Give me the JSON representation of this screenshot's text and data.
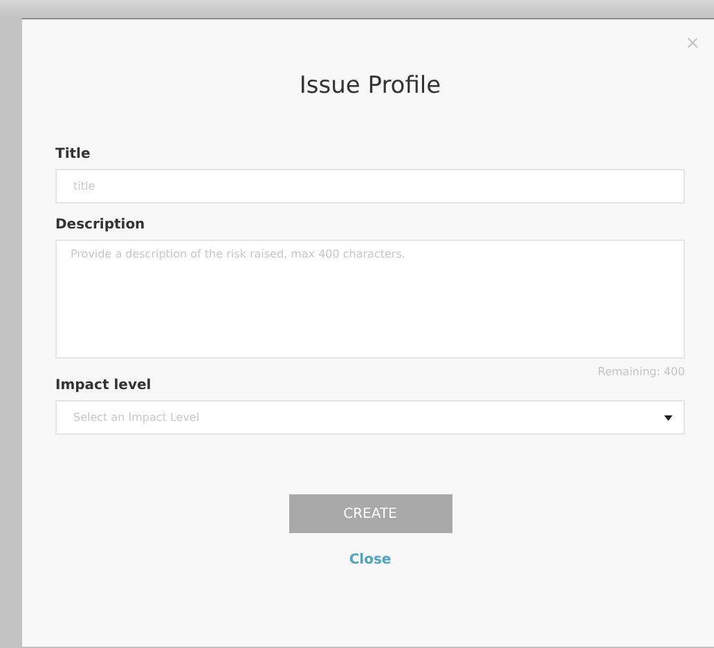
{
  "dialog": {
    "title": "Issue Profile",
    "close_icon": "×"
  },
  "fields": [
    {
      "kind": "input",
      "label": "Title",
      "placeholder": "title"
    },
    {
      "kind": "textarea",
      "label": "Description",
      "placeholder": "Provide a description of the risk raised, max 400 characters.",
      "counter": "Remaining: 400"
    },
    {
      "kind": "select",
      "label": "Impact level",
      "placeholder": "Select an Impact Level"
    }
  ],
  "create_button": {
    "label": "CREATE",
    "disabled": true
  },
  "close_link": "Close"
}
